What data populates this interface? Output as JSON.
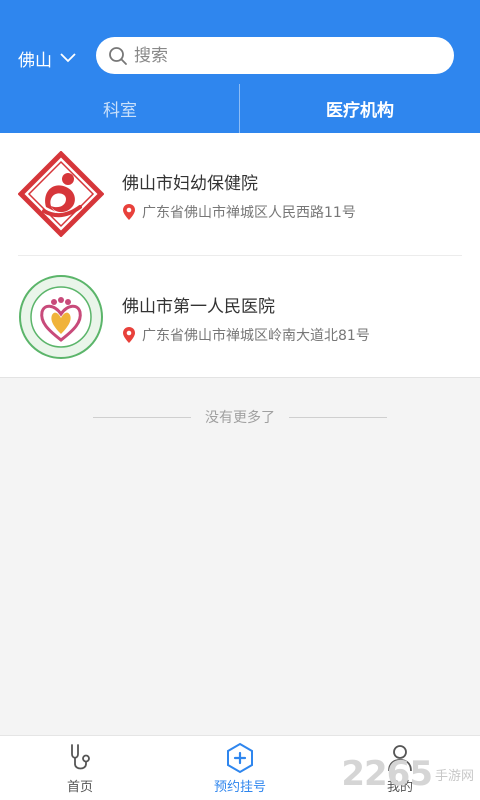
{
  "header": {
    "city": "佛山",
    "search_placeholder": "搜索",
    "tabs": [
      {
        "label": "科室",
        "active": false
      },
      {
        "label": "医疗机构",
        "active": true
      }
    ]
  },
  "hospitals": [
    {
      "name": "佛山市妇幼保健院",
      "address": "广东省佛山市禅城区人民西路11号"
    },
    {
      "name": "佛山市第一人民医院",
      "address": "广东省佛山市禅城区岭南大道北81号"
    }
  ],
  "end_message": "没有更多了",
  "bottom_nav": [
    {
      "label": "首页",
      "icon": "stethoscope-icon",
      "active": false
    },
    {
      "label": "预约挂号",
      "icon": "plus-hexagon-icon",
      "active": true
    },
    {
      "label": "我的",
      "icon": "user-icon",
      "active": false
    }
  ],
  "watermark": {
    "main": "2265",
    "sub": "手游网"
  },
  "colors": {
    "primary": "#2f86ee",
    "pin": "#e8413b",
    "logo1": "#d6363a",
    "logo2_ring": "#5bb56a"
  }
}
